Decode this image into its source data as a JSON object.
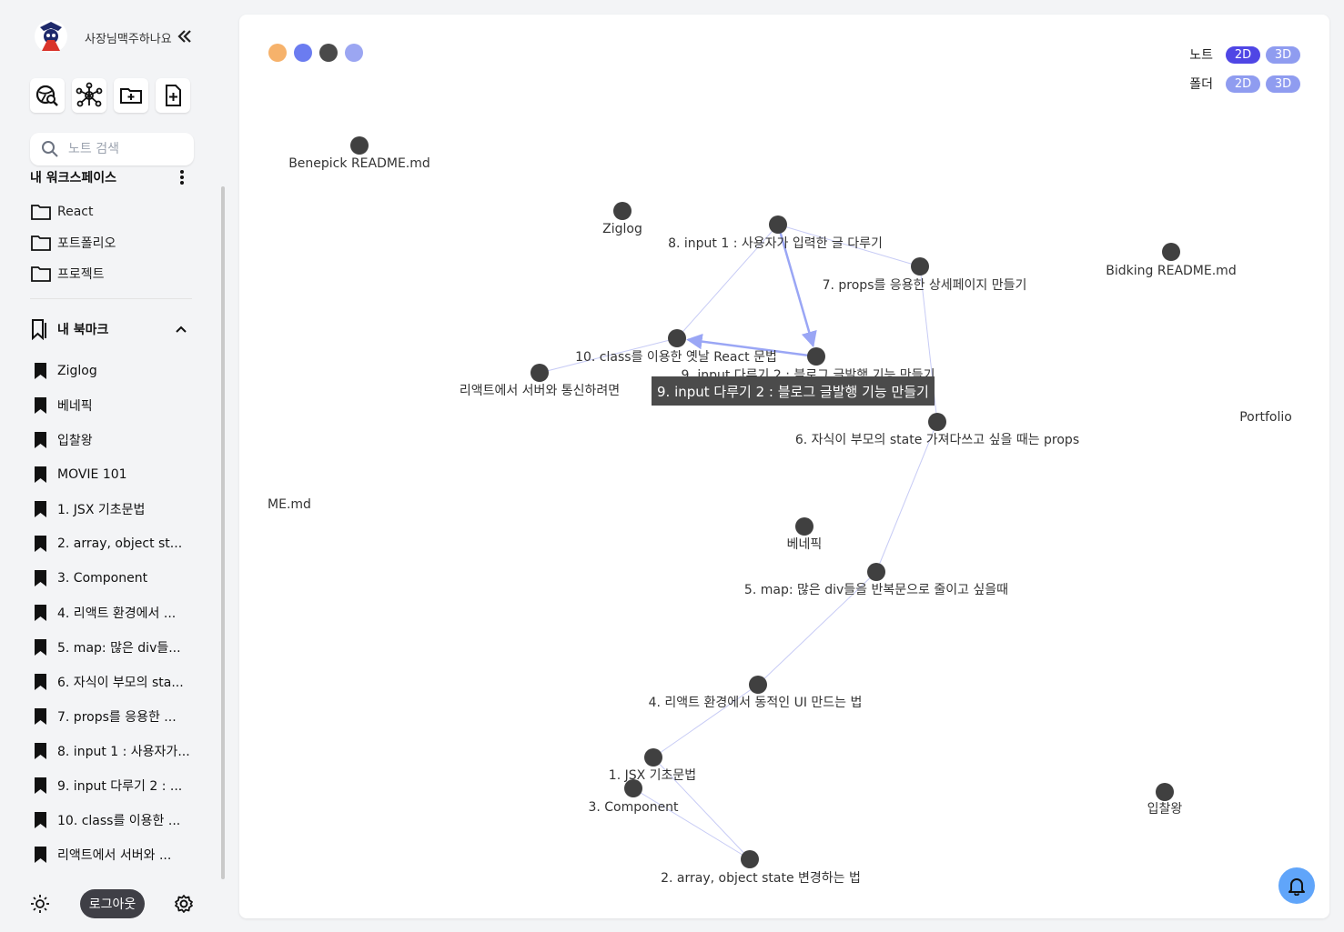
{
  "user": {
    "name": "사장님맥주하나요"
  },
  "search": {
    "placeholder": "노트 검색"
  },
  "workspace": {
    "title": "내 워크스페이스",
    "folders": [
      {
        "label": "React"
      },
      {
        "label": "포트폴리오"
      },
      {
        "label": "프로젝트"
      }
    ]
  },
  "bookmarks": {
    "title": "내 북마크",
    "items": [
      {
        "label": "Ziglog"
      },
      {
        "label": "베네픽"
      },
      {
        "label": "입찰왕"
      },
      {
        "label": "MOVIE 101"
      },
      {
        "label": "1. JSX 기초문법"
      },
      {
        "label": "2. array, object st..."
      },
      {
        "label": "3. Component"
      },
      {
        "label": "4. 리액트 환경에서 ..."
      },
      {
        "label": "5. map: 많은 div들..."
      },
      {
        "label": "6. 자식이 부모의 sta..."
      },
      {
        "label": "7. props를 응용한 ..."
      },
      {
        "label": "8. input 1 : 사용자가..."
      },
      {
        "label": "9. input 다루기 2 : ..."
      },
      {
        "label": "10. class를 이용한 ..."
      },
      {
        "label": "리액트에서 서버와 ..."
      }
    ]
  },
  "footer": {
    "logout_label": "로그아웃"
  },
  "theme_dots": [
    "#f6b26b",
    "#6b7cf0",
    "#4a4a4a",
    "#9ba6f2"
  ],
  "view_modes": {
    "note_label": "노트",
    "folder_label": "폴더",
    "two_d": "2D",
    "three_d": "3D",
    "note_active": "2D"
  },
  "graph": {
    "nodes": [
      {
        "id": "benepick-readme",
        "label": "Benepick README.md"
      },
      {
        "id": "ziglog",
        "label": "Ziglog"
      },
      {
        "id": "n8",
        "label": "8. input 1 : 사용자가 입력한 글 다루기"
      },
      {
        "id": "n7",
        "label": "7. props를 응용한 상세페이지 만들기"
      },
      {
        "id": "bidking-readme",
        "label": "Bidking README.md"
      },
      {
        "id": "n10",
        "label": "10. class를 이용한 옛날 React 문법"
      },
      {
        "id": "n9",
        "label": "9. input 다루기 2 : 블로그 글발행 기능 만들기"
      },
      {
        "id": "server",
        "label": "리액트에서 서버와 통신하려면"
      },
      {
        "id": "portfolio",
        "label": "Portfolio"
      },
      {
        "id": "n6",
        "label": "6. 자식이 부모의 state 가져다쓰고 싶을 때는 props"
      },
      {
        "id": "readme-partial",
        "label": "ME.md"
      },
      {
        "id": "benepick",
        "label": "베네픽"
      },
      {
        "id": "n5",
        "label": "5. map: 많은 div들을 반복문으로 줄이고 싶을때"
      },
      {
        "id": "n4",
        "label": "4. 리액트 환경에서 동적인 UI 만드는 법"
      },
      {
        "id": "n1",
        "label": "1. JSX 기초문법"
      },
      {
        "id": "n3",
        "label": "3. Component"
      },
      {
        "id": "ipchal",
        "label": "입찰왕"
      },
      {
        "id": "n2",
        "label": "2. array, object state 변경하는 법"
      }
    ],
    "links": [
      [
        "n8",
        "n10"
      ],
      [
        "n8",
        "n7"
      ],
      [
        "n8",
        "n9"
      ],
      [
        "n9",
        "n10"
      ],
      [
        "n10",
        "server"
      ],
      [
        "n7",
        "n6"
      ],
      [
        "n6",
        "n5"
      ],
      [
        "n5",
        "n4"
      ],
      [
        "n4",
        "n1"
      ],
      [
        "n1",
        "n2"
      ],
      [
        "n3",
        "n2"
      ]
    ],
    "tooltip": "9. input 다루기 2 : 블로그 글발행 기능 만들기"
  },
  "colors": {
    "node": "#404040",
    "link": "#c7cbf5",
    "highlight_link": "#9aa6f5",
    "accent": "#4f46e5",
    "bell": "#60a5fa"
  }
}
